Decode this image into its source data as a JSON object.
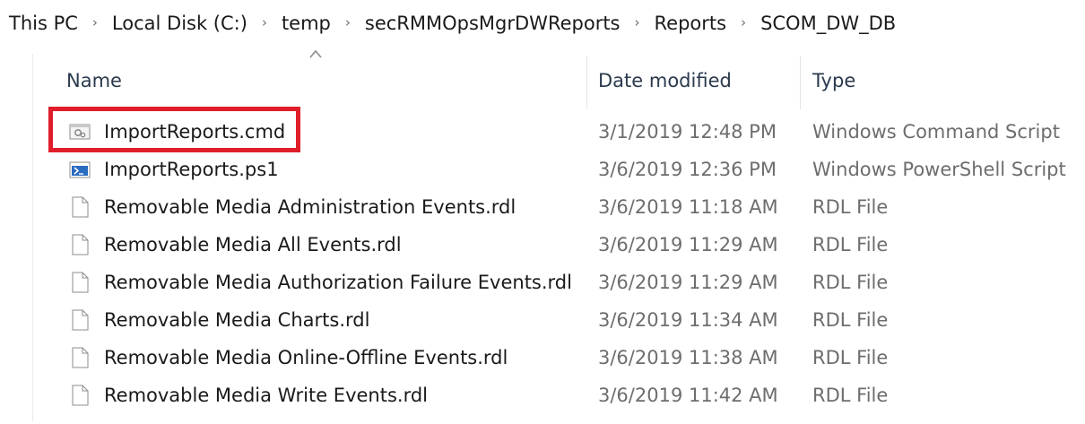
{
  "breadcrumb": {
    "items": [
      "This PC",
      "Local Disk (C:)",
      "temp",
      "secRMMOpsMgrDWReports",
      "Reports",
      "SCOM_DW_DB"
    ],
    "separator": "›"
  },
  "columns": {
    "name": "Name",
    "date": "Date modified",
    "type": "Type"
  },
  "files": [
    {
      "name": "ImportReports.cmd",
      "date": "3/1/2019 12:48 PM",
      "type": "Windows Command Script",
      "icon": "cmd-script-icon",
      "highlighted": true
    },
    {
      "name": "ImportReports.ps1",
      "date": "3/6/2019 12:36 PM",
      "type": "Windows PowerShell Script",
      "icon": "powershell-script-icon",
      "highlighted": false
    },
    {
      "name": "Removable Media Administration Events.rdl",
      "date": "3/6/2019 11:18 AM",
      "type": "RDL File",
      "icon": "file-icon",
      "highlighted": false
    },
    {
      "name": "Removable Media All Events.rdl",
      "date": "3/6/2019 11:29 AM",
      "type": "RDL File",
      "icon": "file-icon",
      "highlighted": false
    },
    {
      "name": "Removable Media Authorization Failure Events.rdl",
      "date": "3/6/2019 11:29 AM",
      "type": "RDL File",
      "icon": "file-icon",
      "highlighted": false
    },
    {
      "name": "Removable Media Charts.rdl",
      "date": "3/6/2019 11:34 AM",
      "type": "RDL File",
      "icon": "file-icon",
      "highlighted": false
    },
    {
      "name": "Removable Media Online-Offline Events.rdl",
      "date": "3/6/2019 11:38 AM",
      "type": "RDL File",
      "icon": "file-icon",
      "highlighted": false
    },
    {
      "name": "Removable Media Write Events.rdl",
      "date": "3/6/2019 11:42 AM",
      "type": "RDL File",
      "icon": "file-icon",
      "highlighted": false
    }
  ],
  "colors": {
    "highlight": "#e01e2b",
    "header_text": "#2b3a4d",
    "secondary_text": "#6d6d6d"
  }
}
